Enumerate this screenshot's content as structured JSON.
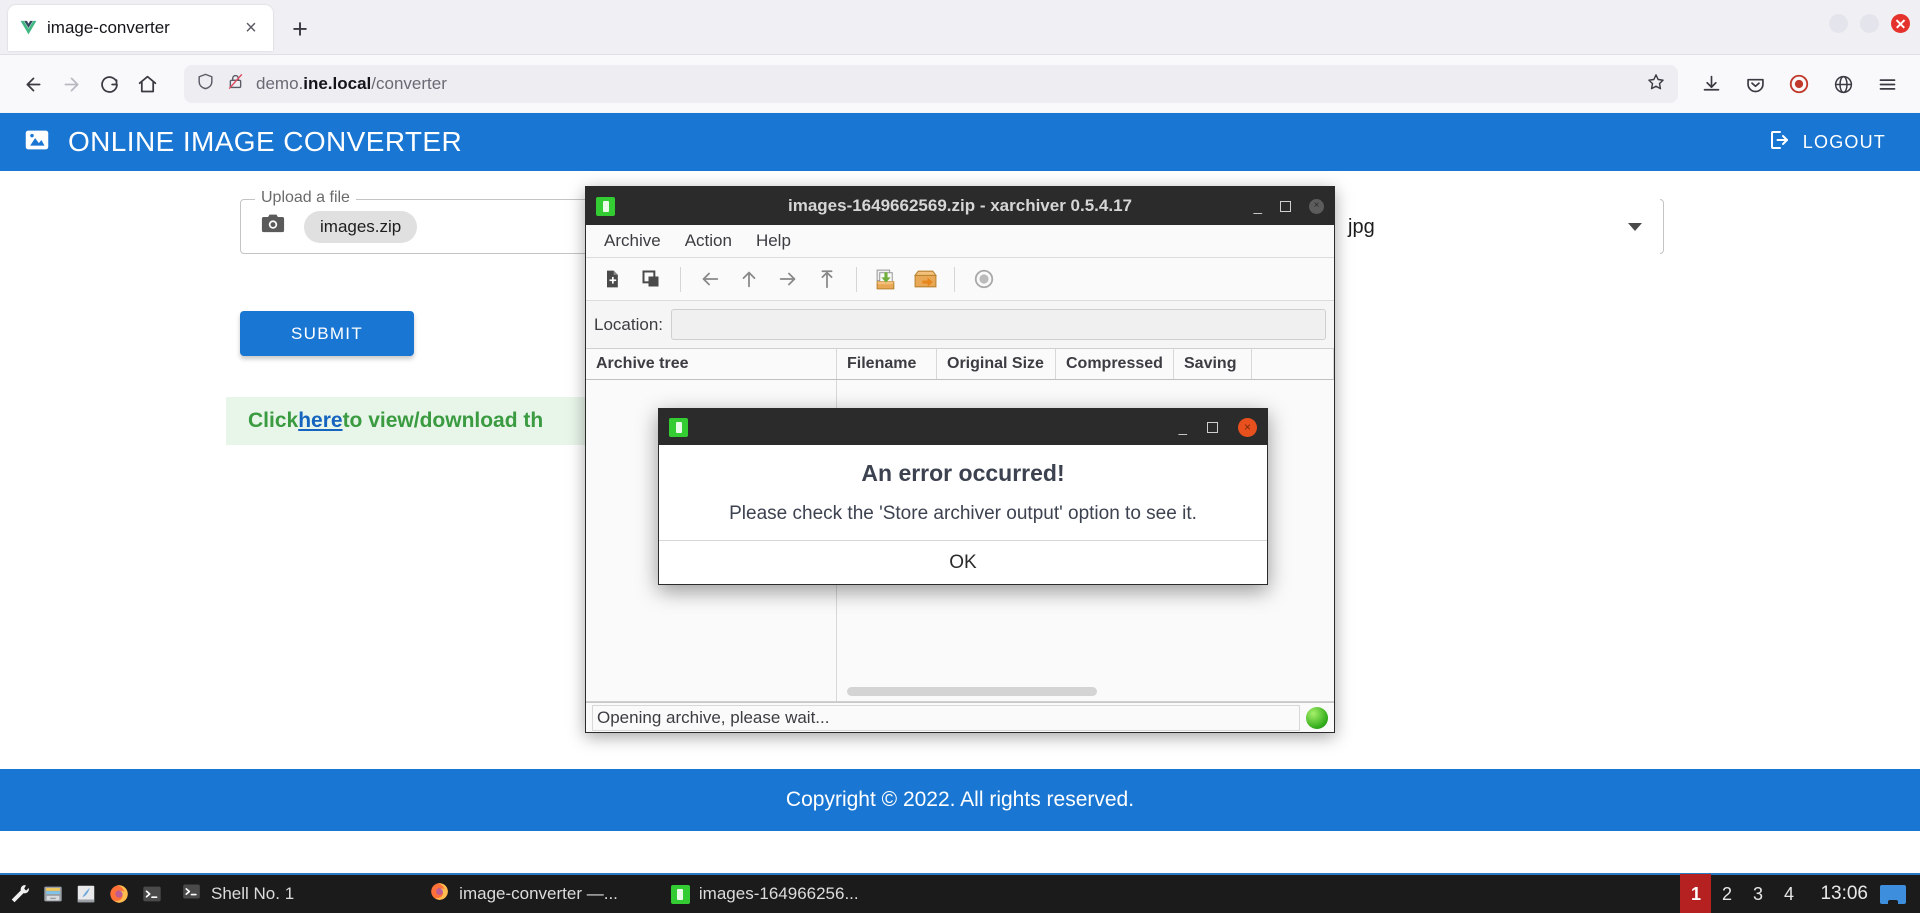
{
  "browser": {
    "tab": {
      "title": "image-converter",
      "favicon": "vue-logo-icon",
      "close_label": "×"
    },
    "newtab_label": "+",
    "url": {
      "prefix": "demo.",
      "bold": "ine.local",
      "suffix": "/converter"
    },
    "nav": {
      "back": "back-arrow-icon",
      "forward": "forward-arrow-icon",
      "reload": "reload-icon",
      "home": "home-icon"
    },
    "toolbar_right": [
      "download-icon",
      "save-to-pocket-icon",
      "shield-icon",
      "extensions-icon",
      "hamburger-menu-icon"
    ]
  },
  "app": {
    "title": "ONLINE IMAGE CONVERTER",
    "logo": "image-icon",
    "logout_label": "LOGOUT",
    "logout_icon": "logout-icon",
    "upload": {
      "legend": "Upload a file",
      "camera_icon": "camera-icon",
      "filename": "images.zip"
    },
    "format_select": {
      "value": "jpg",
      "caret": "chevron-down-icon"
    },
    "submit_label": "SUBMIT",
    "alert": {
      "prefix": "Click ",
      "link": "here",
      "suffix": " to view/download th"
    },
    "footer": "Copyright © 2022. All rights reserved."
  },
  "xarchiver": {
    "title": "images-1649662569.zip - xarchiver 0.5.4.17",
    "app_icon": "archive-icon",
    "window_buttons": {
      "minimize": "_",
      "maximize": "□",
      "close": "×"
    },
    "menus": [
      "Archive",
      "Action",
      "Help"
    ],
    "toolbar": [
      "new-archive-icon",
      "open-archive-icon",
      "back-icon",
      "up-icon",
      "forward-icon",
      "home-icon",
      "add-files-icon",
      "extract-files-icon",
      "stop-icon"
    ],
    "location_label": "Location:",
    "location_value": "",
    "columns": [
      "Archive tree",
      "Filename",
      "Original Size",
      "Compressed",
      "Saving"
    ],
    "rows": [],
    "status_text": "Opening archive, please wait...",
    "status_led": "green-led-icon"
  },
  "error_dialog": {
    "app_icon": "archive-icon",
    "window_buttons": {
      "minimize": "_",
      "maximize": "□",
      "close": "×"
    },
    "heading": "An error occurred!",
    "message": "Please check the 'Store archiver output' option to see it.",
    "ok_label": "OK"
  },
  "taskbar": {
    "launchers": [
      "wrench-icon",
      "file-manager-icon",
      "text-editor-icon",
      "firefox-icon",
      "terminal-icon"
    ],
    "tasks": [
      {
        "icon": "terminal-icon",
        "label": "Shell No. 1"
      },
      {
        "icon": "firefox-icon",
        "label": "image-converter —..."
      },
      {
        "icon": "archive-icon",
        "label": "images-164966256..."
      }
    ],
    "workspaces": [
      "1",
      "2",
      "3",
      "4"
    ],
    "active_workspace": "1",
    "clock": "13:06",
    "tray": [
      "desktop-icon"
    ]
  },
  "colors": {
    "brand_blue": "#1976d2",
    "success_green": "#3a9b41",
    "alert_bg": "#e8f5e9",
    "link_blue": "#1565c0",
    "taskbar_bg": "#1b1b1b",
    "workspace_active": "#b52121"
  }
}
